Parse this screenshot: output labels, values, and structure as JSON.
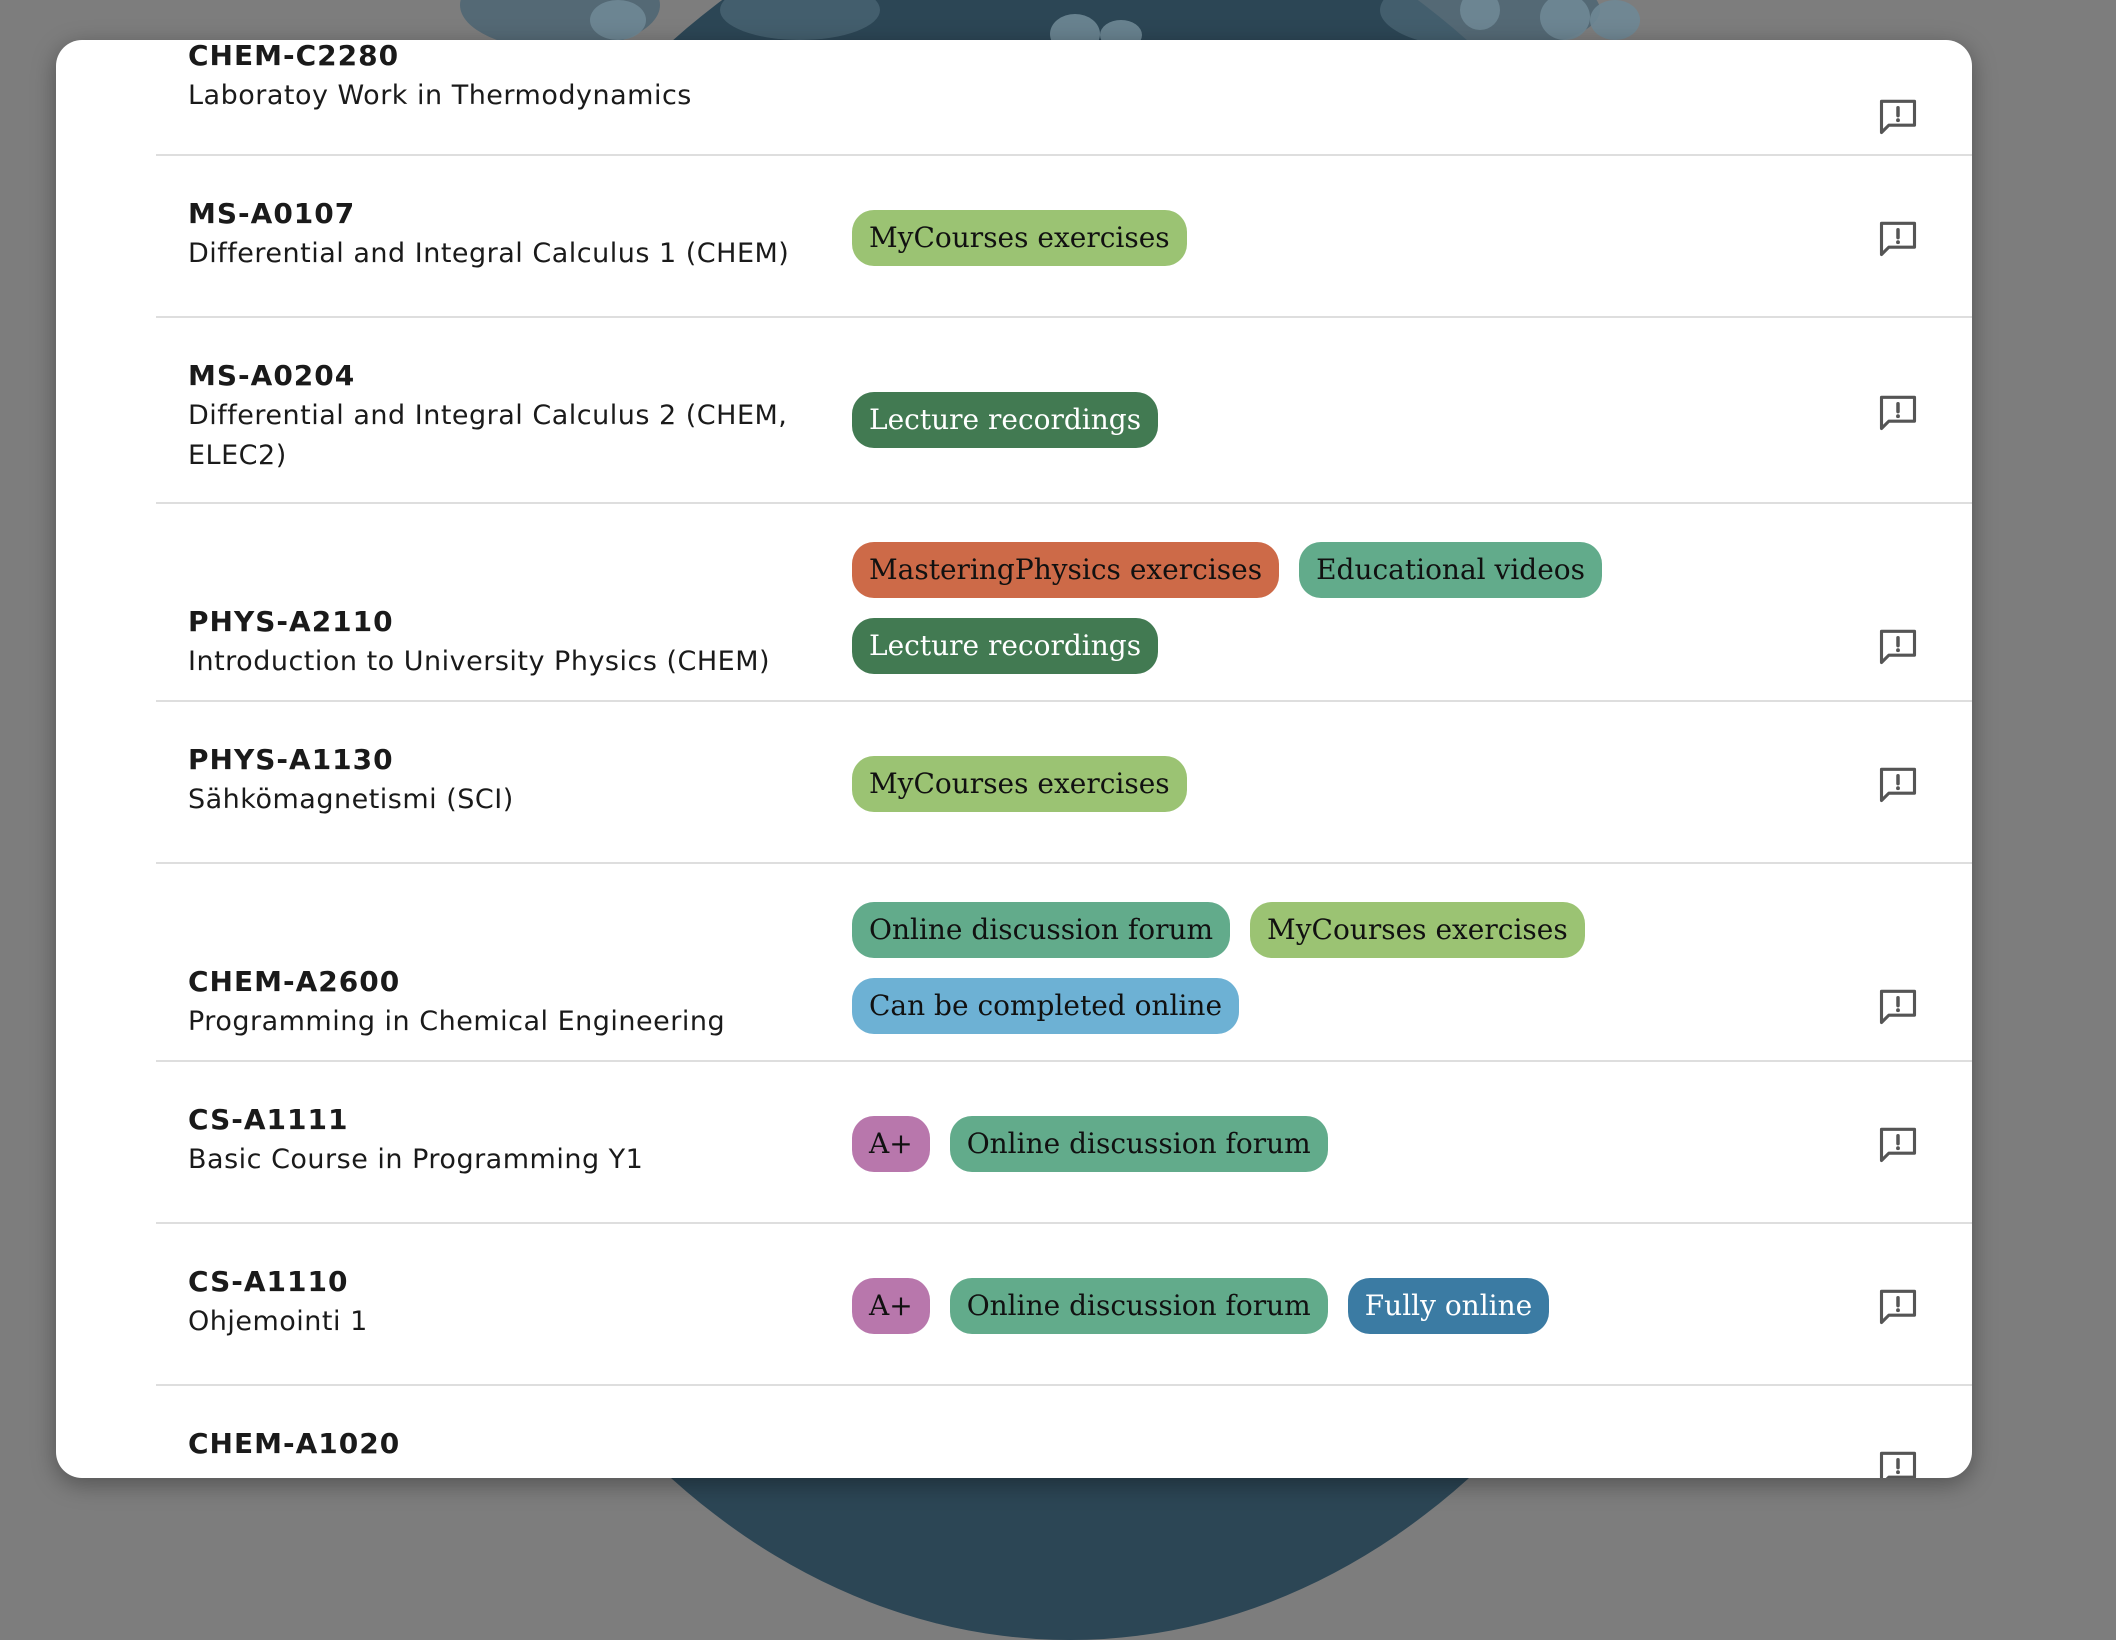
{
  "background": {
    "color": "#7d7d7d",
    "shape_color": "#2c4655"
  },
  "courses": [
    {
      "code": "CHEM-C2280",
      "name_lines": [
        "Laboratoy Work in Thermodynamics"
      ],
      "tag_lines": []
    },
    {
      "code": "MS-A0107",
      "name_lines": [
        "Differential and Integral Calculus 1 (CHEM)"
      ],
      "tag_lines": [
        [
          {
            "label": "MyCourses exercises",
            "style": "light-green"
          }
        ]
      ]
    },
    {
      "code": "MS-A0204",
      "name_lines": [
        "Differential and Integral Calculus 2 (CHEM,",
        "ELEC2)"
      ],
      "tag_lines": [
        [
          {
            "label": "Lecture recordings",
            "style": "dark-green"
          }
        ]
      ]
    },
    {
      "code": "PHYS-A2110",
      "name_lines": [
        "Introduction to University Physics (CHEM)"
      ],
      "tag_lines": [
        [
          {
            "label": "MasteringPhysics exercises",
            "style": "orange"
          },
          {
            "label": "Educational videos",
            "style": "teal"
          }
        ],
        [
          {
            "label": "Lecture recordings",
            "style": "dark-green"
          }
        ]
      ]
    },
    {
      "code": "PHYS-A1130",
      "name_lines": [
        "Sähkömagnetismi (SCI)"
      ],
      "tag_lines": [
        [
          {
            "label": "MyCourses exercises",
            "style": "light-green"
          }
        ]
      ]
    },
    {
      "code": "CHEM-A2600",
      "name_lines": [
        "Programming in Chemical Engineering"
      ],
      "tag_lines": [
        [
          {
            "label": "Online discussion forum",
            "style": "teal"
          },
          {
            "label": "MyCourses exercises",
            "style": "light-green"
          }
        ],
        [
          {
            "label": "Can be completed online",
            "style": "sky"
          }
        ]
      ]
    },
    {
      "code": "CS-A1111",
      "name_lines": [
        "Basic Course in Programming Y1"
      ],
      "tag_lines": [
        [
          {
            "label": "A+",
            "style": "purple"
          },
          {
            "label": "Online discussion forum",
            "style": "teal"
          }
        ]
      ]
    },
    {
      "code": "CS-A1110",
      "name_lines": [
        "Ohjemointi 1"
      ],
      "tag_lines": [
        [
          {
            "label": "A+",
            "style": "purple"
          },
          {
            "label": "Online discussion forum",
            "style": "teal"
          },
          {
            "label": "Fully online",
            "style": "steel"
          }
        ]
      ]
    },
    {
      "code": "CHEM-A1020",
      "name_lines": [],
      "tag_lines": []
    }
  ],
  "icons": {
    "feedback": "feedback-icon"
  },
  "tag_colors": {
    "light-green": "#9bc373",
    "dark-green": "#427a52",
    "orange": "#cd6a48",
    "teal": "#62ab8b",
    "sky": "#6db1d4",
    "purple": "#b877ac",
    "steel": "#3b7ba3"
  }
}
